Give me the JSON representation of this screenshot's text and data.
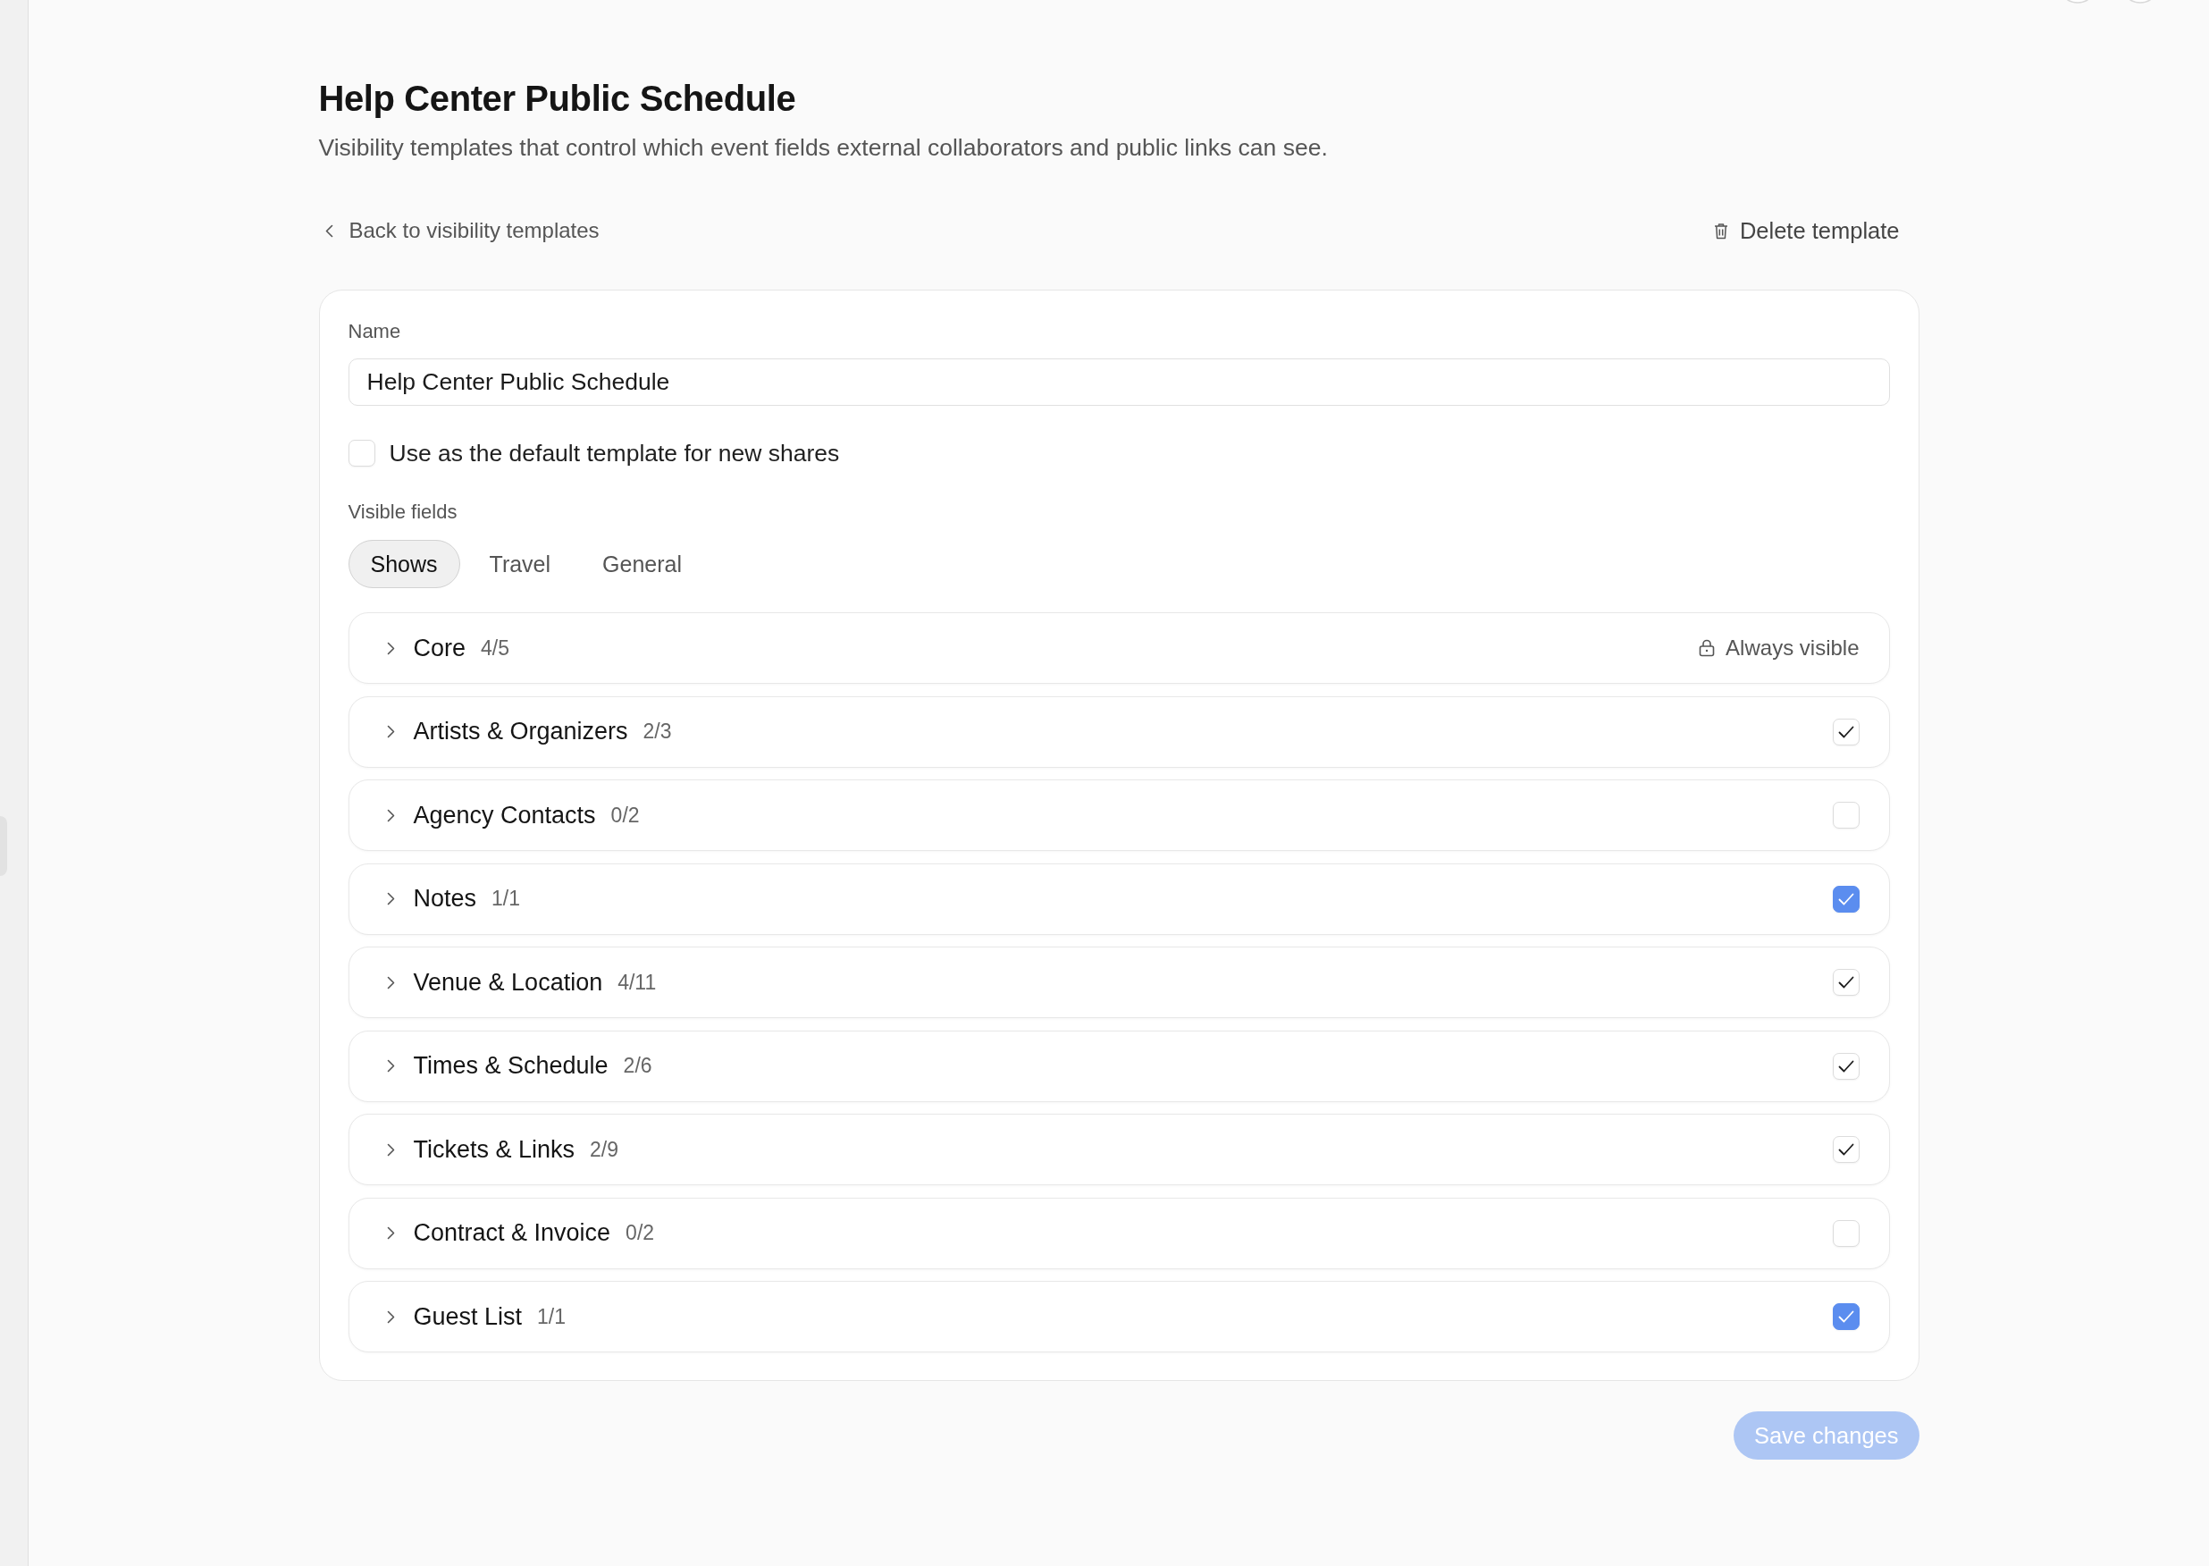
{
  "page": {
    "title": "Help Center Public Schedule",
    "description": "Visibility templates that control which event fields external collaborators and public links can see."
  },
  "back_link": "Back to visibility templates",
  "delete_button": "Delete template",
  "form": {
    "name_field": {
      "label": "Name",
      "value": "Help Center Public Schedule"
    },
    "default_checkbox": {
      "label": "Use as the default template for new shares",
      "checked": false
    },
    "visible_fields": {
      "label": "Visible fields",
      "tabs": [
        {
          "label": "Shows",
          "selected": true
        },
        {
          "label": "Travel",
          "selected": false
        },
        {
          "label": "General",
          "selected": false
        }
      ],
      "groups": [
        {
          "kind": "locked",
          "name": "Core",
          "count": "4/5",
          "expanded": false,
          "note": "Always visible"
        },
        {
          "kind": "toggle",
          "name": "Artists & Organizers",
          "count": "2/3",
          "expanded": false,
          "checked": false,
          "partial": true
        },
        {
          "kind": "toggle",
          "name": "Agency Contacts",
          "count": "0/2",
          "expanded": false,
          "checked": false,
          "partial": false
        },
        {
          "kind": "toggle",
          "name": "Notes",
          "count": "1/1",
          "expanded": false,
          "checked": true,
          "partial": false
        },
        {
          "kind": "toggle",
          "name": "Venue & Location",
          "count": "4/11",
          "expanded": false,
          "checked": false,
          "partial": true
        },
        {
          "kind": "toggle",
          "name": "Times & Schedule",
          "count": "2/6",
          "expanded": false,
          "checked": false,
          "partial": true
        },
        {
          "kind": "toggle",
          "name": "Tickets & Links",
          "count": "2/9",
          "expanded": false,
          "checked": false,
          "partial": true
        },
        {
          "kind": "toggle",
          "name": "Contract & Invoice",
          "count": "0/2",
          "expanded": false,
          "checked": false,
          "partial": false
        },
        {
          "kind": "toggle",
          "name": "Guest List",
          "count": "1/1",
          "expanded": false,
          "checked": true,
          "partial": false
        }
      ]
    }
  },
  "save_button": {
    "label": "Save changes",
    "disabled": true
  }
}
